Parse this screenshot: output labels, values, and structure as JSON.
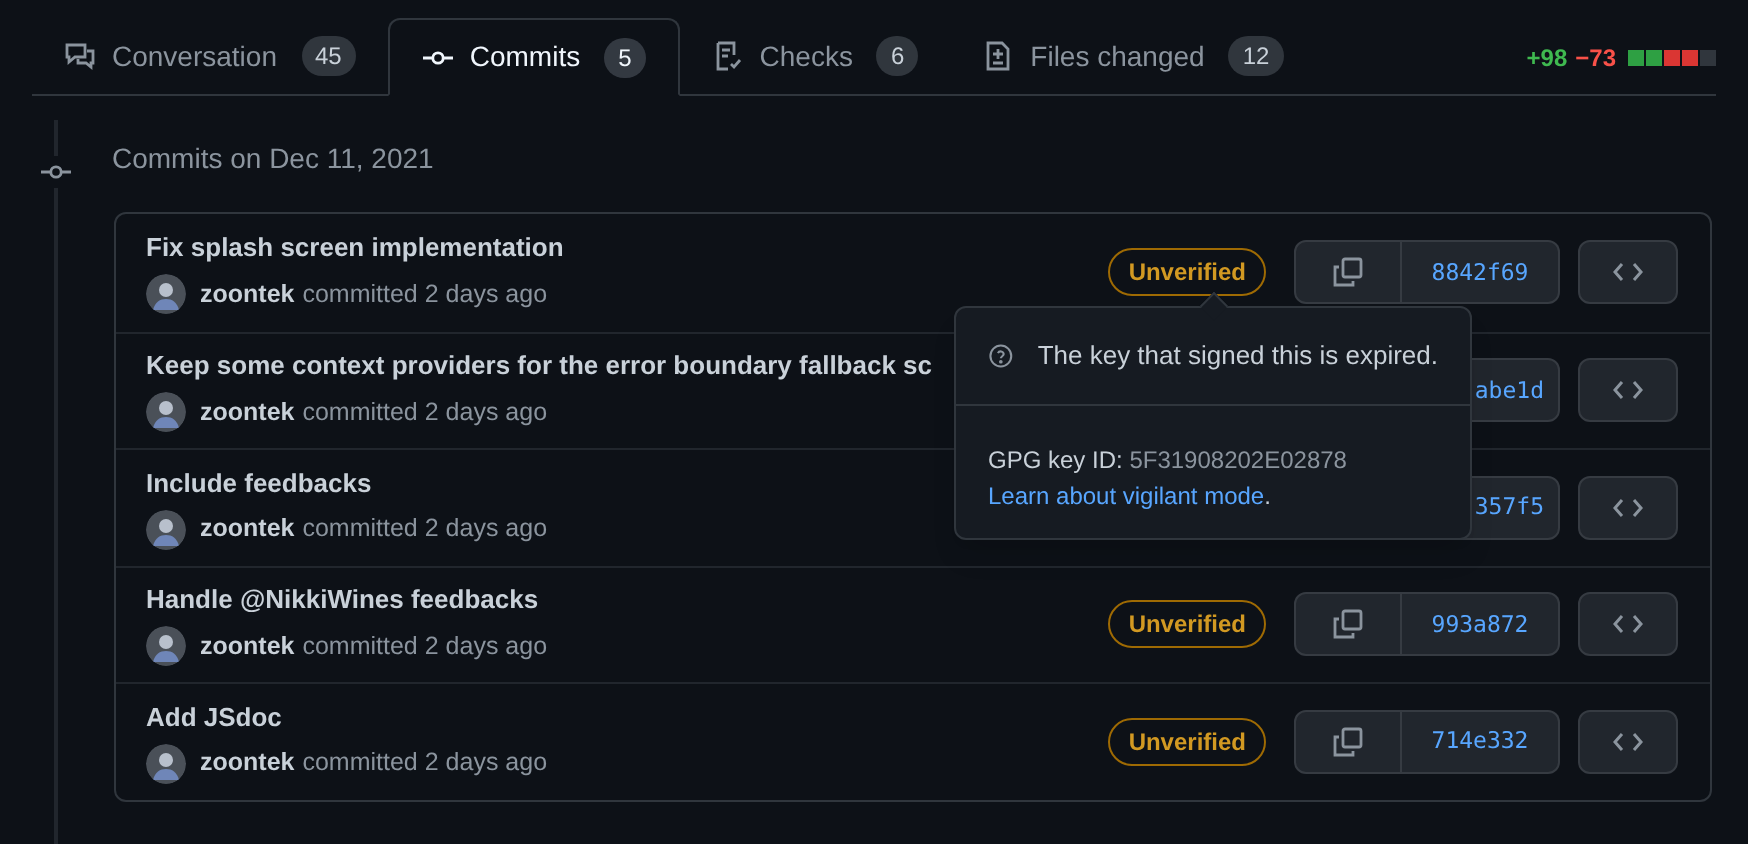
{
  "tabs": [
    {
      "kind": "conversation",
      "label": "Conversation",
      "count": "45",
      "selected": false
    },
    {
      "kind": "commits",
      "label": "Commits",
      "count": "5",
      "selected": true
    },
    {
      "kind": "checks",
      "label": "Checks",
      "count": "6",
      "selected": false
    },
    {
      "kind": "files",
      "label": "Files changed",
      "count": "12",
      "selected": false
    }
  ],
  "diffstat": {
    "additions": "+98",
    "deletions": "−73",
    "blocks": [
      {
        "color": "#2ea043"
      },
      {
        "color": "#2ea043"
      },
      {
        "color": "#da3633"
      },
      {
        "color": "#da3633"
      },
      {
        "color": "#30363d"
      }
    ]
  },
  "group_heading": "Commits on Dec 11, 2021",
  "commits": [
    {
      "title": "Fix splash screen implementation",
      "author": "zoontek",
      "meta": "committed 2 days ago",
      "badge": "Unverified",
      "copy_visible": true,
      "sha": "8842f69"
    },
    {
      "title": "Keep some context providers for the error boundary fallback sc",
      "author": "zoontek",
      "meta": "committed 2 days ago",
      "copy_visible": false,
      "sha": "abe1d"
    },
    {
      "title": "Include feedbacks",
      "author": "zoontek",
      "meta": "committed 2 days ago",
      "copy_visible": false,
      "sha": "357f5"
    },
    {
      "title": "Handle @NikkiWines feedbacks",
      "author": "zoontek",
      "meta": "committed 2 days ago",
      "badge": "Unverified",
      "copy_visible": true,
      "sha": "993a872"
    },
    {
      "title": "Add JSdoc",
      "author": "zoontek",
      "meta": "committed 2 days ago",
      "badge": "Unverified",
      "copy_visible": true,
      "sha": "714e332"
    }
  ],
  "popover": {
    "message": "The key that signed this is expired.",
    "key_label": "GPG key ID:",
    "key_id": "5F31908202E02878",
    "link": "Learn about vigilant mode",
    "link_suffix": "."
  }
}
